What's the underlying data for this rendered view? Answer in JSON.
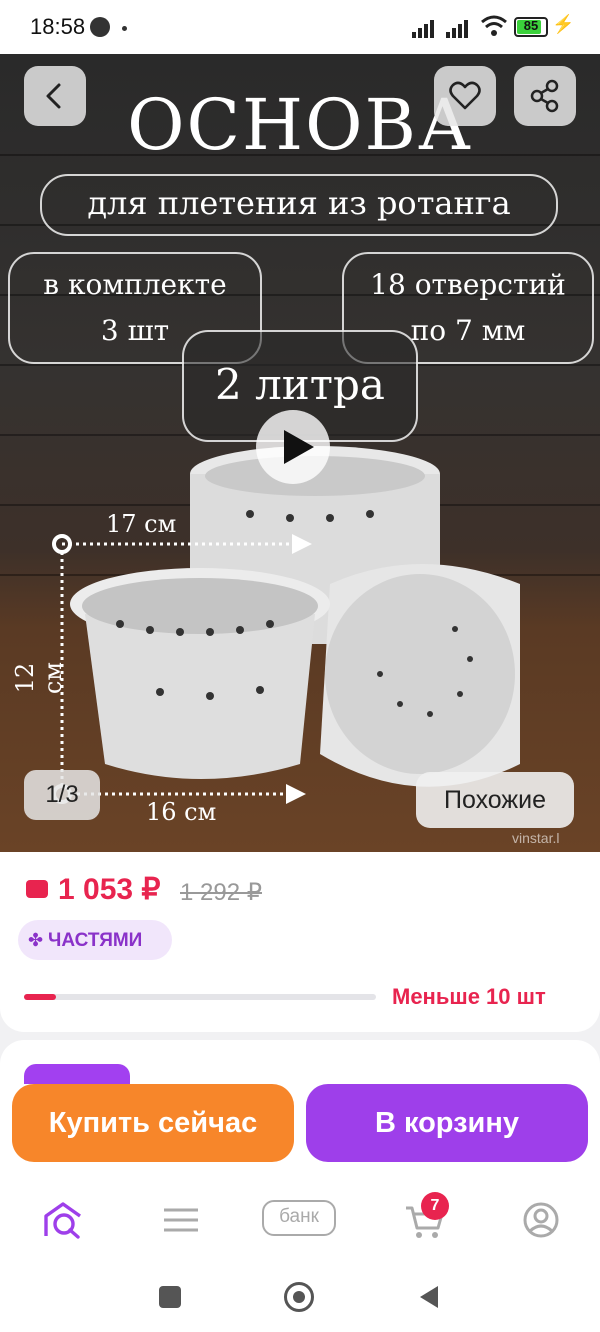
{
  "status_bar": {
    "time": "18:58",
    "battery": "85"
  },
  "hero": {
    "title": "ОСНОВА",
    "subtitle": "для плетения из ротанга",
    "badge_left_line1": "в комплекте",
    "badge_left_line2": "3 шт",
    "badge_right_line1": "18 отверстий",
    "badge_right_line2": "по 7 мм",
    "badge_center": "2 литра",
    "dim_top": "17 см",
    "dim_side": "12 см",
    "dim_bottom": "16 см",
    "counter": "1/3",
    "similar_button": "Похожие",
    "watermark": "vinstar.l"
  },
  "price": {
    "current": "1 053 ₽",
    "old": "1 292 ₽",
    "installment": "ЧАСТЯМИ",
    "stock_text": "Меньше 10 шт",
    "stock_level": 0.09
  },
  "actions": {
    "buy_now": "Купить сейчас",
    "add_to_cart": "В корзину"
  },
  "tabbar": {
    "bank_label": "банк",
    "cart_count": "7"
  },
  "colors": {
    "accent_red": "#e8244f",
    "purple": "#9e3fea",
    "orange": "#f7862a"
  }
}
